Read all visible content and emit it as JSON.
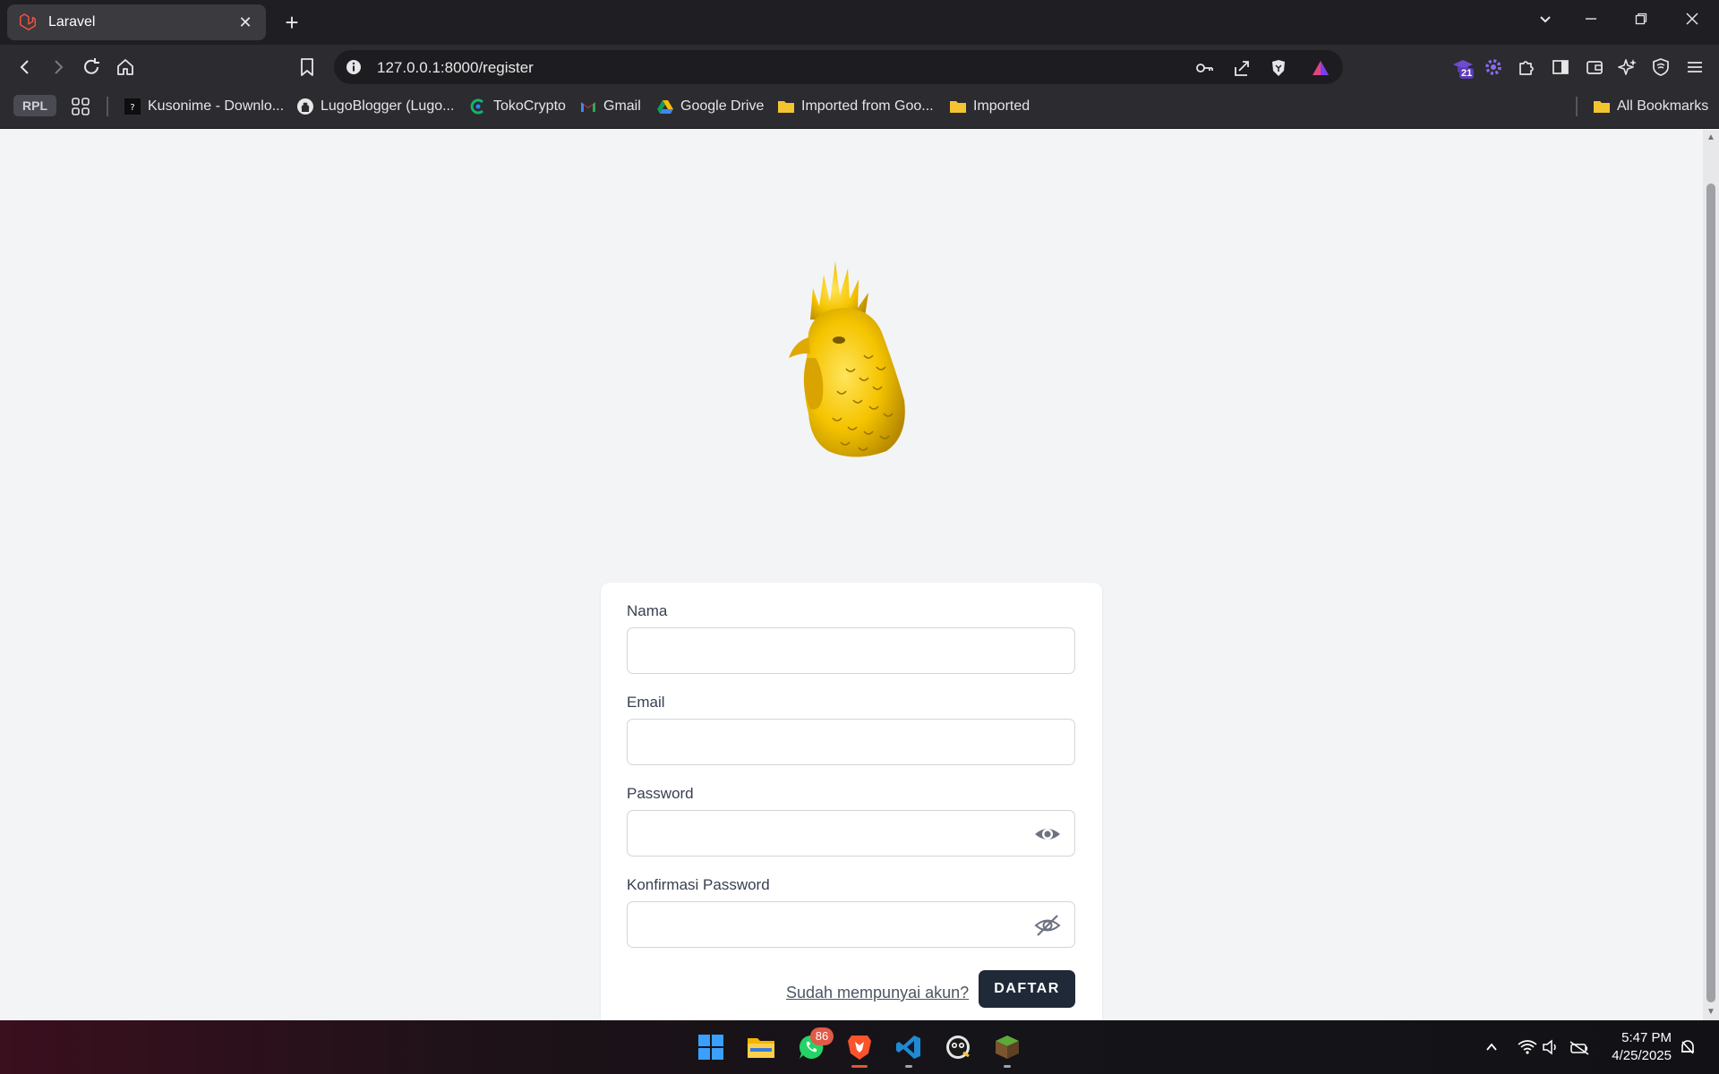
{
  "browser": {
    "tab_title": "Laravel",
    "tab_close": "✕",
    "new_tab": "+",
    "url": "127.0.0.1:8000/register",
    "extension_badge": "21"
  },
  "bookmarks": {
    "rpl": "RPL",
    "items": [
      {
        "label": "Kusonime - Downlo...",
        "icon": "kusonime-icon"
      },
      {
        "label": "LugoBlogger (Lugo...",
        "icon": "github-icon"
      },
      {
        "label": "TokoCrypto",
        "icon": "tokocrypto-icon"
      },
      {
        "label": "Gmail",
        "icon": "gmail-icon"
      },
      {
        "label": "Google Drive",
        "icon": "google-drive-icon"
      },
      {
        "label": "Imported from Goo...",
        "icon": "folder-icon"
      },
      {
        "label": "Imported",
        "icon": "folder-icon"
      }
    ],
    "all_bookmarks": "All Bookmarks"
  },
  "form": {
    "name_label": "Nama",
    "email_label": "Email",
    "password_label": "Password",
    "confirm_label": "Konfirmasi Password",
    "name_value": "",
    "email_value": "",
    "password_value": "",
    "confirm_value": "",
    "login_link": "Sudah mempunyai akun?",
    "submit_label": "DAFTAR"
  },
  "taskbar": {
    "whatsapp_badge": "86",
    "time": "5:47 PM",
    "date": "4/25/2025"
  },
  "colors": {
    "logo": "#f5c400",
    "button": "#1f2937",
    "page_bg": "#f3f4f6"
  }
}
